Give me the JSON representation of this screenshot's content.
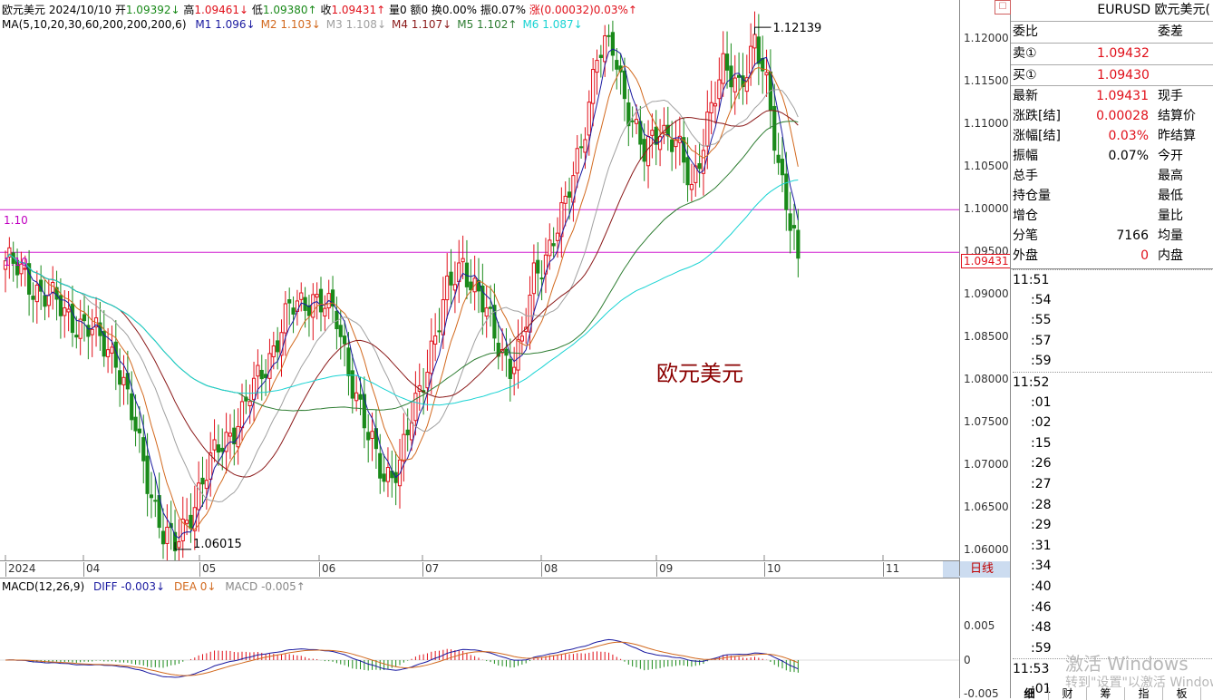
{
  "header": {
    "symbol": "欧元美元",
    "date": "2024/10/10",
    "open_label": "开",
    "open": "1.09392↓",
    "high_label": "高",
    "high": "1.09461↓",
    "low_label": "低",
    "low": "1.09380↑",
    "close_label": "收",
    "close": "1.09431↑",
    "volume": "量0",
    "amount": "额0",
    "turnover": "换0.00%",
    "amplitude": "振0.07%",
    "change": "涨(0.00032)0.03%↑"
  },
  "ma_legend": {
    "title": "MA(5,10,20,30,60,200,200,200,6)",
    "items": [
      {
        "label": "M1 1.096↓",
        "color": "#1a1aa0"
      },
      {
        "label": "M2 1.103↓",
        "color": "#d2691e"
      },
      {
        "label": "M3 1.108↓",
        "color": "#a0a0a0"
      },
      {
        "label": "M4 1.107↓",
        "color": "#8b1a1a"
      },
      {
        "label": "M5 1.102↑",
        "color": "#2e7d32"
      },
      {
        "label": "M6 1.087↓",
        "color": "#19d3d3"
      }
    ]
  },
  "macd_legend": {
    "title": "MACD(12,26,9)",
    "diff": "DIFF -0.003↓",
    "dea": "DEA 0↓",
    "macd": "MACD -0.005↑"
  },
  "annotations": {
    "high_label": "1.12139",
    "low_label": "1.06015",
    "watermark": "欧元美元",
    "hline1_label": "1.10",
    "hline2_label": "1.10",
    "last_price_tag": "1.09431",
    "period_button": "日线"
  },
  "chart_data": {
    "type": "candlestick",
    "price_ticks": [
      "1.12000",
      "1.11500",
      "1.11000",
      "1.10500",
      "1.10000",
      "1.09500",
      "1.09000",
      "1.08500",
      "1.08000",
      "1.07500",
      "1.07000",
      "1.06500",
      "1.06000"
    ],
    "price_range": [
      1.0595,
      1.123
    ],
    "month_labels": [
      "2024",
      "04",
      "05",
      "06",
      "07",
      "08",
      "09",
      "10",
      "11"
    ],
    "macd_ticks": [
      "0.005",
      "0",
      "-0.005"
    ],
    "horizontal_lines": [
      1.1,
      1.095
    ],
    "anchors": [
      [
        0,
        1.094
      ],
      [
        5,
        1.092
      ],
      [
        15,
        1.088
      ],
      [
        22,
        1.0855
      ],
      [
        28,
        1.083
      ],
      [
        34,
        1.072
      ],
      [
        40,
        1.062
      ],
      [
        43,
        1.0602
      ],
      [
        48,
        1.066
      ],
      [
        54,
        1.072
      ],
      [
        60,
        1.076
      ],
      [
        66,
        1.082
      ],
      [
        72,
        1.088
      ],
      [
        78,
        1.09
      ],
      [
        84,
        1.087
      ],
      [
        88,
        1.08
      ],
      [
        92,
        1.073
      ],
      [
        96,
        1.069
      ],
      [
        100,
        1.07
      ],
      [
        104,
        1.077
      ],
      [
        108,
        1.084
      ],
      [
        112,
        1.09
      ],
      [
        116,
        1.094
      ],
      [
        120,
        1.09
      ],
      [
        124,
        1.085
      ],
      [
        128,
        1.082
      ],
      [
        131,
        1.084
      ],
      [
        134,
        1.092
      ],
      [
        138,
        1.096
      ],
      [
        142,
        1.1
      ],
      [
        146,
        1.108
      ],
      [
        150,
        1.118
      ],
      [
        154,
        1.119
      ],
      [
        158,
        1.112
      ],
      [
        162,
        1.106
      ],
      [
        166,
        1.11
      ],
      [
        170,
        1.108
      ],
      [
        174,
        1.102
      ],
      [
        178,
        1.111
      ],
      [
        182,
        1.116
      ],
      [
        186,
        1.115
      ],
      [
        190,
        1.1195
      ],
      [
        193,
        1.114
      ],
      [
        196,
        1.106
      ],
      [
        199,
        1.099
      ],
      [
        201,
        1.0943
      ]
    ],
    "series": [
      {
        "name": "M1",
        "period": 5,
        "color": "#1a1aa0"
      },
      {
        "name": "M2",
        "period": 10,
        "color": "#d2691e"
      },
      {
        "name": "M3",
        "period": 20,
        "color": "#a0a0a0"
      },
      {
        "name": "M4",
        "period": 30,
        "color": "#8b1a1a"
      },
      {
        "name": "M5",
        "period": 60,
        "color": "#2e7d32"
      },
      {
        "name": "M6",
        "period": 200,
        "color": "#19d3d3"
      }
    ],
    "up_color": "#e0101a",
    "down_color": "#1a8a1a"
  },
  "side_panel": {
    "title": "EURUSD 欧元美元(",
    "bid_ratio_label": "委比",
    "bid_diff_label": "委差",
    "sell_label": "卖①",
    "sell_value": "1.09432",
    "buy_label": "买①",
    "buy_value": "1.09430",
    "rows": [
      {
        "l": "最新",
        "v": "1.09431",
        "r": "现手",
        "rv": "",
        "vc": "#e0101a"
      },
      {
        "l": "涨跌[结]",
        "v": "0.00028",
        "r": "结算价",
        "rv": "",
        "vc": "#e0101a"
      },
      {
        "l": "涨幅[结]",
        "v": "0.03%",
        "r": "昨结算",
        "rv": "",
        "vc": "#e0101a"
      },
      {
        "l": "振幅",
        "v": "0.07%",
        "r": "今开",
        "rv": "",
        "vc": "#000"
      },
      {
        "l": "总手",
        "v": "",
        "r": "最高",
        "rv": "",
        "vc": "#000"
      },
      {
        "l": "持仓量",
        "v": "",
        "r": "最低",
        "rv": "",
        "vc": "#000"
      },
      {
        "l": "增仓",
        "v": "",
        "r": "量比",
        "rv": "",
        "vc": "#000"
      },
      {
        "l": "分笔",
        "v": "7166",
        "r": "均量",
        "rv": "",
        "vc": "#000"
      },
      {
        "l": "外盘",
        "v": "0",
        "r": "内盘",
        "rv": "",
        "vc": "#e0101a"
      }
    ],
    "times": [
      "11:51",
      ":54",
      ":55",
      ":57",
      ":59",
      "11:52",
      ":01",
      ":02",
      ":15",
      ":26",
      ":27",
      ":28",
      ":29",
      ":31",
      ":34",
      ":40",
      ":46",
      ":48",
      ":59",
      "11:53",
      ":01"
    ],
    "tabs": [
      "细",
      "财",
      "筹",
      "指",
      "板"
    ],
    "activate_line1": "激活 Windows",
    "activate_line2": "转到\"设置\"以激活 Windows"
  }
}
